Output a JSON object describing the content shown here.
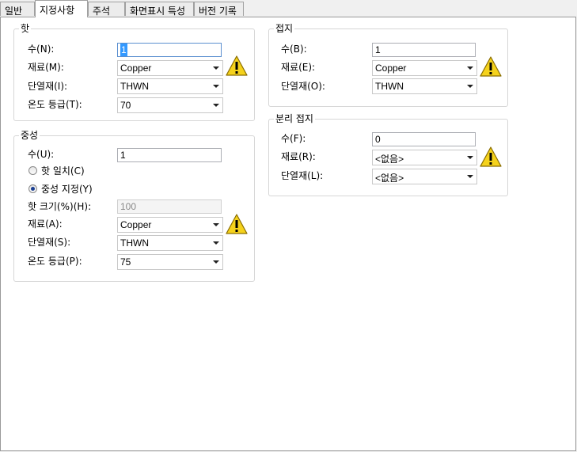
{
  "tabs": [
    "일반",
    "지정사항",
    "주석",
    "화면표시 특성",
    "버전 기록"
  ],
  "hot": {
    "title": "핫",
    "count_label": "수(N):",
    "count_value": "1",
    "material_label": "재료(M):",
    "material_value": "Copper",
    "insulation_label": "단열재(I):",
    "insulation_value": "THWN",
    "temp_label": "온도 등급(T):",
    "temp_value": "70"
  },
  "neutral": {
    "title": "중성",
    "count_label": "수(U):",
    "count_value": "1",
    "radio_match_label": "핫 일치(C)",
    "radio_specify_label": "중성 지정(Y)",
    "size_label": "핫 크기(%)(H):",
    "size_value": "100",
    "material_label": "재료(A):",
    "material_value": "Copper",
    "insulation_label": "단열재(S):",
    "insulation_value": "THWN",
    "temp_label": "온도 등급(P):",
    "temp_value": "75"
  },
  "ground": {
    "title": "접지",
    "count_label": "수(B):",
    "count_value": "1",
    "material_label": "재료(E):",
    "material_value": "Copper",
    "insulation_label": "단열재(O):",
    "insulation_value": "THWN"
  },
  "isolated_ground": {
    "title": "분리 접지",
    "count_label": "수(F):",
    "count_value": "0",
    "material_label": "재료(R):",
    "material_value": "<없음>",
    "insulation_label": "단열재(L):",
    "insulation_value": "<없음>"
  },
  "colors": {
    "warning_fill": "#f5d21c",
    "selection": "#3399ff",
    "panel_bg": "#ffffff"
  }
}
